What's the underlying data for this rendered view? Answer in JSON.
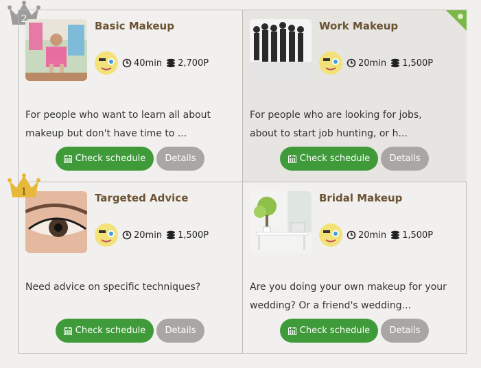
{
  "courses": [
    {
      "title": "Basic Makeup",
      "duration": "40min",
      "price": "2,700P",
      "desc_line1": "For people who want to learn all about",
      "desc_line2": "makeup but don't have time to ...",
      "schedule_label": "Check schedule",
      "details_label": "Details",
      "rank": "2"
    },
    {
      "title": "Work Makeup",
      "duration": "20min",
      "price": "1,500P",
      "desc_line1": "For people who are looking for jobs,",
      "desc_line2": "about to start job hunting, or h...",
      "schedule_label": "Check schedule",
      "details_label": "Details"
    },
    {
      "title": "Targeted Advice",
      "duration": "20min",
      "price": "1,500P",
      "desc_line1": "Need advice on specific techniques?",
      "desc_line2": "",
      "schedule_label": "Check schedule",
      "details_label": "Details",
      "rank": "1"
    },
    {
      "title": "Bridal Makeup",
      "duration": "20min",
      "price": "1,500P",
      "desc_line1": "Are you doing your own makeup for your",
      "desc_line2": "wedding? Or a friend's wedding...",
      "schedule_label": "Check schedule",
      "details_label": "Details"
    }
  ],
  "colors": {
    "primary_button": "#3f9b3a",
    "secondary_button": "#a9a7a5",
    "title_text": "#6b5333",
    "gold_crown": "#e7b93a",
    "silver_crown": "#9c9c9c"
  },
  "icons": {
    "duration": "clock-icon",
    "price": "coins-icon",
    "schedule": "calendar-icon",
    "avatar": "instructor-avatar-icon",
    "rank": "crown-icon"
  }
}
